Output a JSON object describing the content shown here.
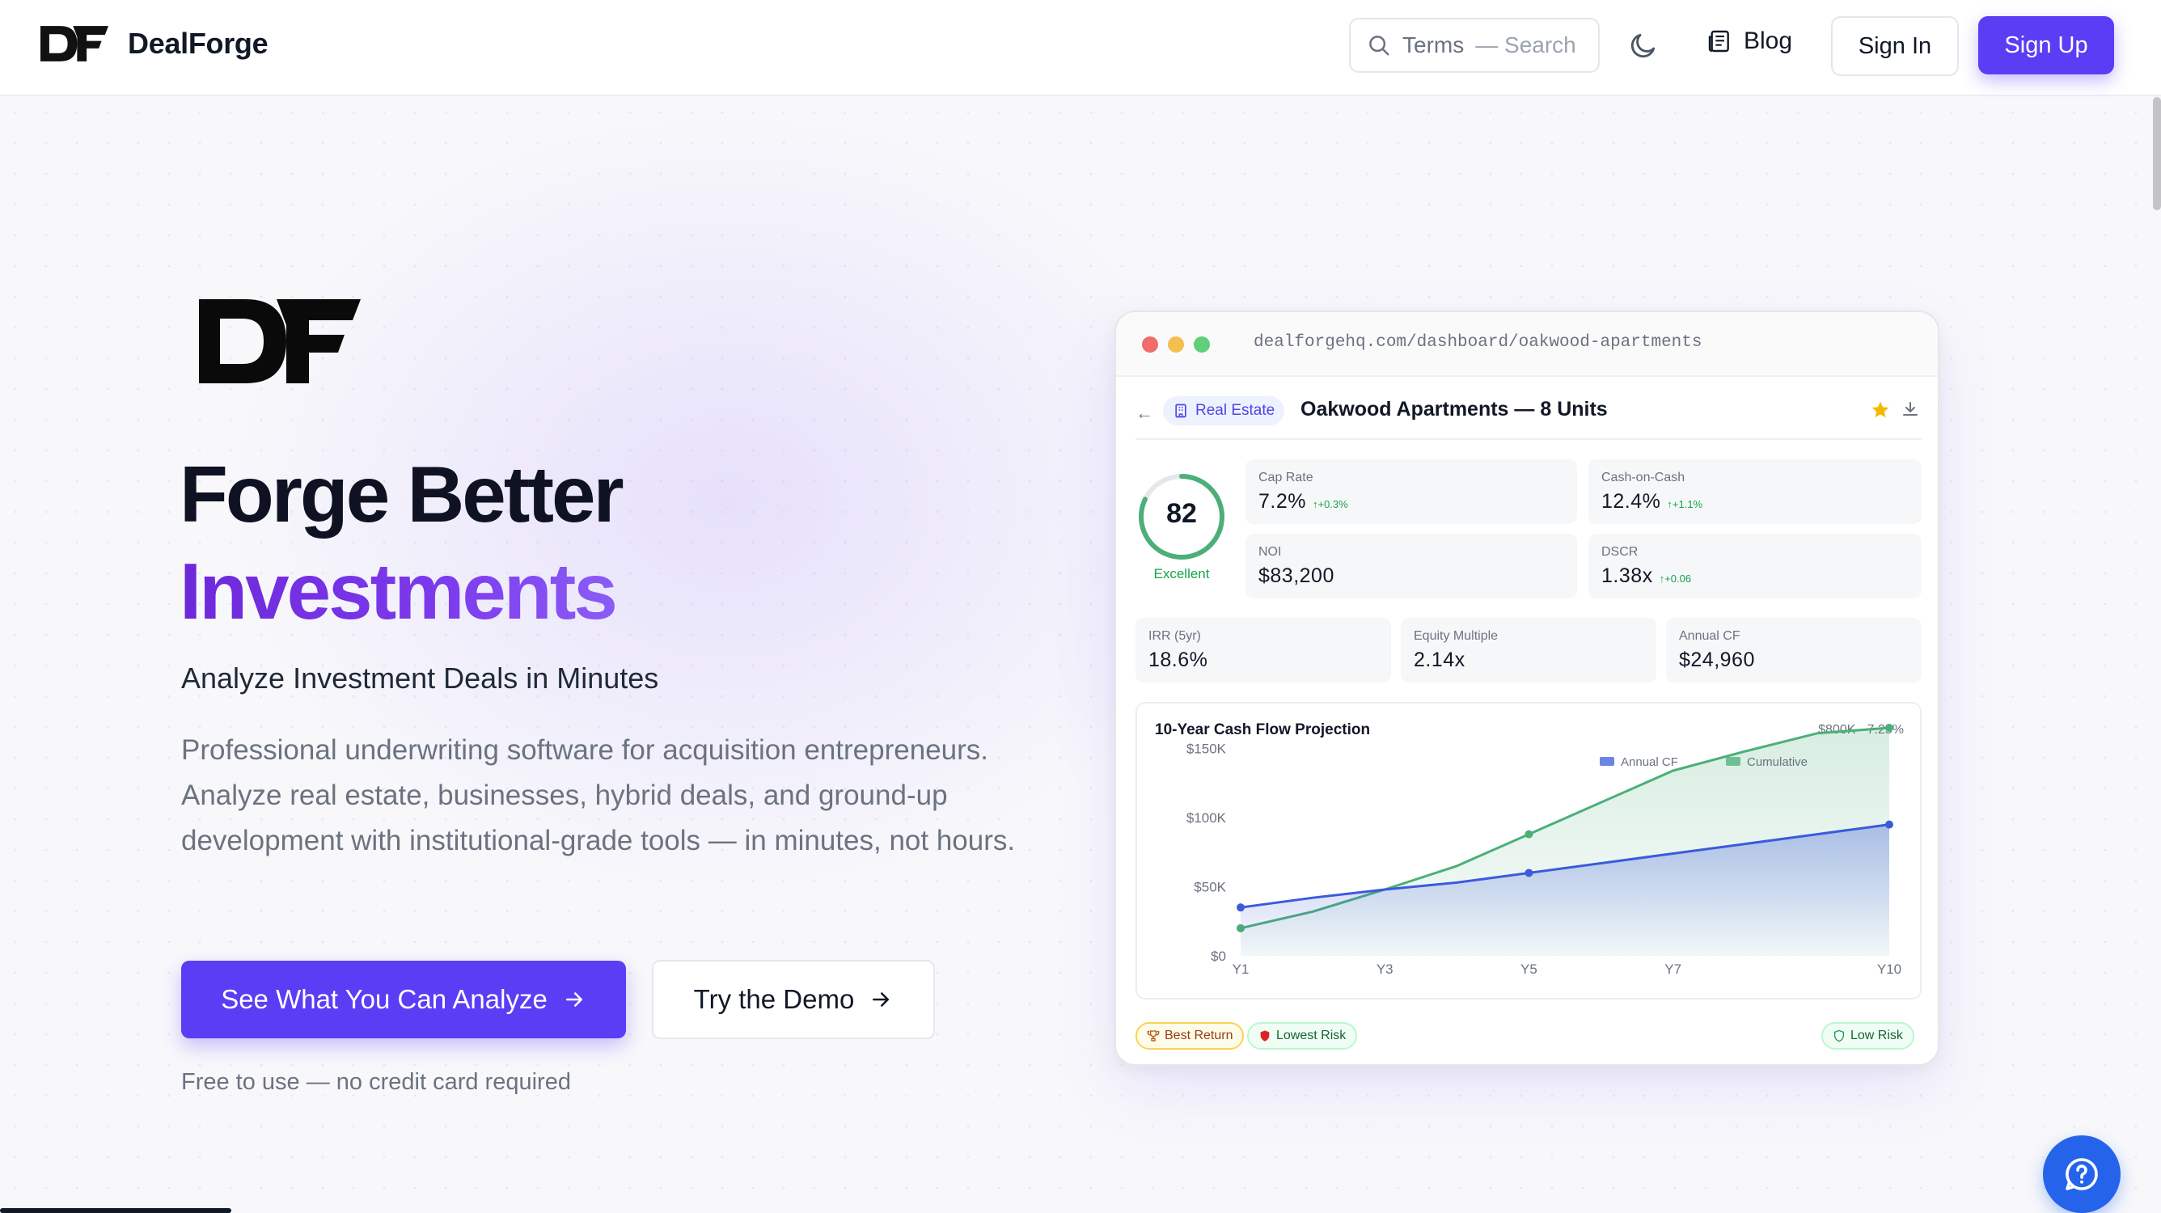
{
  "nav": {
    "brand_name": "DealForge",
    "search_placeholder_a": "Terms",
    "search_placeholder_b": "— Search",
    "blog": "Blog",
    "sign_in": "Sign In",
    "sign_up": "Sign Up"
  },
  "hero": {
    "title_line1": "Forge Better",
    "title_line2": "Investments",
    "subtitle": "Analyze Investment Deals in Minutes",
    "description": "Professional underwriting software for acquisition entrepreneurs. Analyze real estate, businesses, hybrid deals, and ground-up development with institutional-grade tools — in minutes, not hours.",
    "cta_primary": "See What You Can Analyze",
    "cta_secondary": "Try the Demo",
    "note": "Free to use — no credit card required"
  },
  "dashboard": {
    "url": "dealforgehq.com/dashboard/oakwood-apartments",
    "tag": "Real Estate",
    "title": "Oakwood Apartments — 8 Units",
    "score": "82",
    "score_label": "Excellent",
    "score_fraction": 0.82,
    "metrics": [
      {
        "label": "Cap Rate",
        "value": "7.2%",
        "delta": "↑+0.3%"
      },
      {
        "label": "Cash-on-Cash",
        "value": "12.4%",
        "delta": "↑+1.1%"
      },
      {
        "label": "NOI",
        "value": "$83,200",
        "delta": ""
      },
      {
        "label": "DSCR",
        "value": "1.38x",
        "delta": "↑+0.06"
      },
      {
        "label": "IRR (5yr)",
        "value": "18.6%",
        "delta": ""
      },
      {
        "label": "Equity Multiple",
        "value": "2.14x",
        "delta": ""
      },
      {
        "label": "Annual CF",
        "value": "$24,960",
        "delta": ""
      }
    ],
    "badges": [
      {
        "label": "Best Return"
      },
      {
        "label": "Lowest Risk"
      },
      {
        "label": "Low Risk"
      }
    ],
    "colors": {
      "accent": "#5b3df5",
      "annual": "#3b5bdb",
      "cumulative": "#4caf78"
    }
  },
  "chart_data": {
    "type": "area",
    "title": "10-Year Cash Flow Projection",
    "subtitle": "$800K · 7.25%",
    "x": [
      1,
      2,
      3,
      4,
      5,
      6,
      7,
      8,
      9,
      10
    ],
    "x_tick_labels": [
      "Y1",
      "Y3",
      "Y5",
      "Y7",
      "Y10"
    ],
    "x_tick_positions": [
      1,
      3,
      5,
      7,
      10
    ],
    "y_tick_labels": [
      "$0",
      "$50K",
      "$100K",
      "$150K"
    ],
    "y_tick_values": [
      0,
      50000,
      100000,
      150000
    ],
    "ylim": [
      0,
      165000
    ],
    "series": [
      {
        "name": "Annual CF",
        "values": [
          35000,
          42000,
          48000,
          53000,
          60000,
          67000,
          74000,
          81000,
          88000,
          95000
        ],
        "markers": [
          1,
          5,
          10
        ]
      },
      {
        "name": "Cumulative",
        "values": [
          20000,
          32000,
          48000,
          65000,
          88000,
          111000,
          134000,
          148000,
          161000,
          165000
        ],
        "markers": [
          1,
          5,
          10
        ]
      }
    ],
    "legend": "top-right",
    "grid": false
  }
}
